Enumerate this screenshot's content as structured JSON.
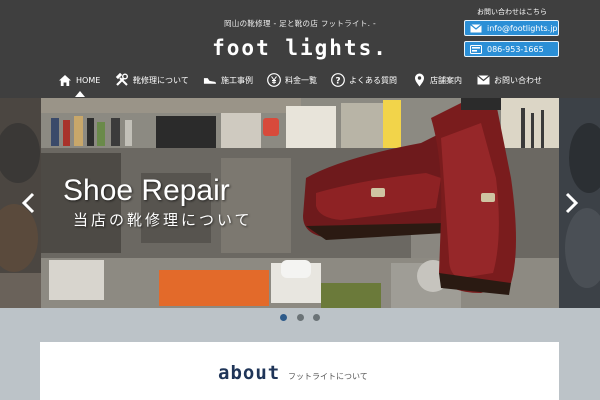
{
  "header": {
    "tagline": "岡山の靴修理 - 足と靴の店 フットライト. -",
    "logo": "foot lights.",
    "contact": {
      "title": "お問い合わせはこちら",
      "email": "info@footlights.jp",
      "phone": "086-953-1665"
    }
  },
  "nav": {
    "items": [
      {
        "label": "HOME",
        "icon": "home-icon"
      },
      {
        "label": "靴修理について",
        "icon": "tools-icon"
      },
      {
        "label": "施工事例",
        "icon": "shoe-icon"
      },
      {
        "label": "料金一覧",
        "icon": "yen-icon"
      },
      {
        "label": "よくある質問",
        "icon": "question-icon"
      },
      {
        "label": "店舗案内",
        "icon": "map-pin-icon"
      },
      {
        "label": "お問い合わせ",
        "icon": "mail-icon"
      }
    ],
    "active": "HOME"
  },
  "hero": {
    "title": "Shoe Repair",
    "subtitle": "当店の靴修理について",
    "slide_count": 3,
    "active_slide": 1
  },
  "about": {
    "title": "about",
    "subtitle": "フットライトについて"
  },
  "colors": {
    "header_bg": "#3f3f3f",
    "contact_button": "#2b8fd6",
    "about_title": "#1f3558",
    "active_dot": "#2d5a8a"
  }
}
